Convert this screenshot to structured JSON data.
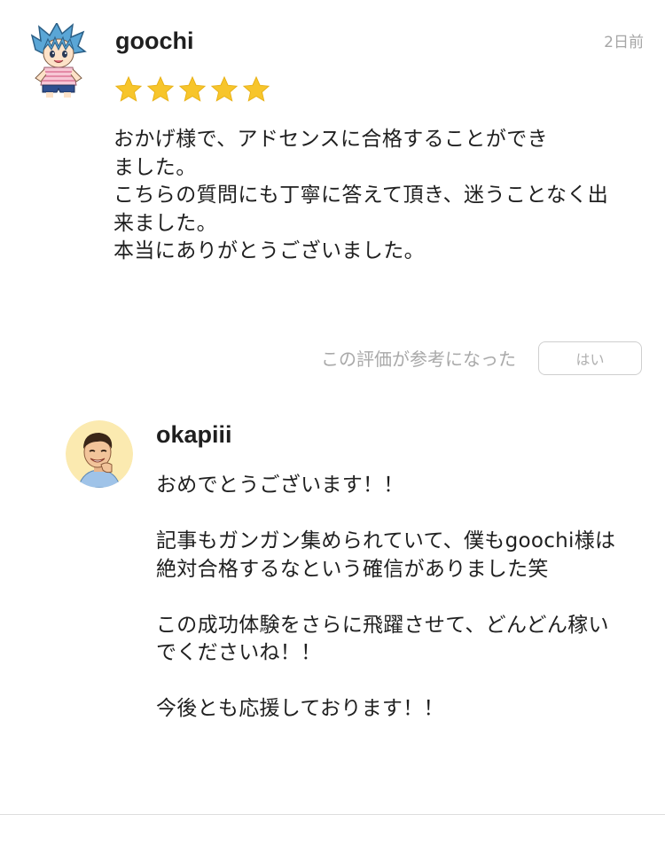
{
  "review": {
    "reviewer_name": "goochi",
    "date": "2日前",
    "rating": 5,
    "star_color": "#F7C52B",
    "body": "おかげ様で、アドセンスに合格することができ\nました。\nこちらの質問にも丁寧に答えて頂き、迷うことなく出\n来ました。\n本当にありがとうございました。",
    "helpful_prompt": "この評価が参考になった",
    "helpful_button": "はい"
  },
  "reply": {
    "replier_name": "okapiii",
    "paragraphs": [
      "おめでとうございます！！",
      "記事もガンガン集められていて、僕もgoochi様は\n絶対合格するなという確信がありました笑",
      "この成功体験をさらに飛躍させて、どんどん稼い\nでくださいね！！",
      "今後とも応援しております！！"
    ]
  }
}
